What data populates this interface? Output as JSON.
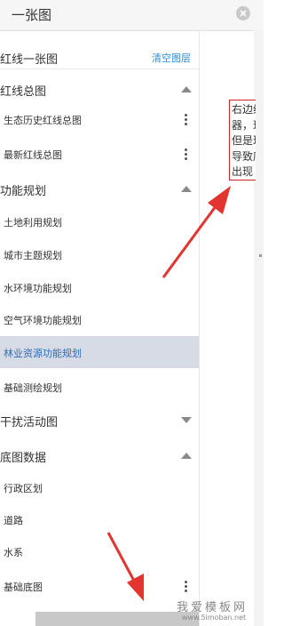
{
  "panel": {
    "title": "一张图",
    "close_icon": "close-icon"
  },
  "top_row": {
    "label": "红线一张图",
    "clear_label": "清空图层"
  },
  "groups": [
    {
      "label": "红线总图",
      "expanded": true,
      "items": [
        {
          "label": "生态历史红线总图",
          "has_menu": true
        },
        {
          "label": "最新红线总图",
          "has_menu": true
        }
      ]
    },
    {
      "label": "功能规划",
      "expanded": true,
      "items": [
        {
          "label": "土地利用规划"
        },
        {
          "label": "城市主题规划"
        },
        {
          "label": "水环境功能规划"
        },
        {
          "label": "空气环境功能规划"
        },
        {
          "label": "林业资源功能规划",
          "selected": true
        },
        {
          "label": "基础测绘规划"
        }
      ]
    },
    {
      "label": "干扰活动图",
      "expanded": false,
      "items": []
    },
    {
      "label": "底图数据",
      "expanded": true,
      "items": [
        {
          "label": "行政区划"
        },
        {
          "label": "道路"
        },
        {
          "label": "水系"
        },
        {
          "label": "基础底图",
          "has_menu": true
        }
      ]
    }
  ],
  "callout": {
    "line1": "右边线",
    "line2": "器，现",
    "line3": "但是现",
    "line4": "导致底",
    "line5": "出现"
  },
  "watermark": {
    "main": "我爱模板网",
    "sub": "www.5imoban.net"
  },
  "colors": {
    "accent": "#2d8cd8",
    "selected_bg": "#d6dbe6",
    "arrow_red": "#e3342f"
  }
}
